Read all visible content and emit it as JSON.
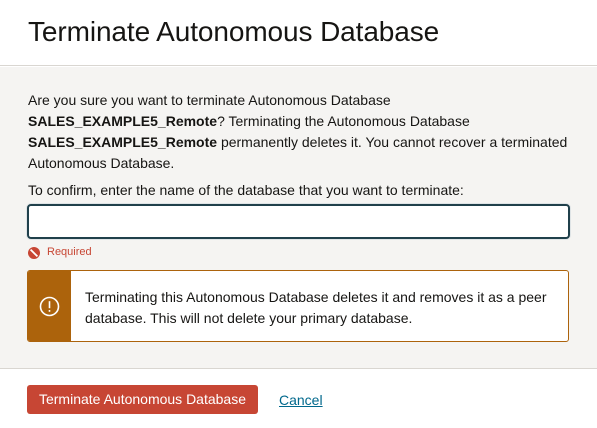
{
  "dialog": {
    "title": "Terminate Autonomous Database"
  },
  "message": {
    "part1": "Are you sure you want to terminate Autonomous Database ",
    "db_name_1": "SALES_EXAMPLE5_Remote",
    "part2": "? Terminating the Autonomous Database ",
    "db_name_2": "SALES_EXAMPLE5_Remote",
    "part3": " permanently deletes it. You cannot recover a terminated Autonomous Database."
  },
  "confirm": {
    "label": "To confirm, enter the name of the database that you want to terminate:",
    "value": "",
    "placeholder": "",
    "validation_message": "Required"
  },
  "warning": {
    "icon": "exclamation-circle-icon",
    "text": "Terminating this Autonomous Database deletes it and removes it as a peer database. This will not delete your primary database."
  },
  "footer": {
    "terminate_label": "Terminate Autonomous Database",
    "cancel_label": "Cancel"
  },
  "colors": {
    "danger": "#c74634",
    "warning": "#ac630c",
    "link": "#00688c",
    "input_focus_border": "#20404b",
    "body_background": "#f5f4f2"
  }
}
